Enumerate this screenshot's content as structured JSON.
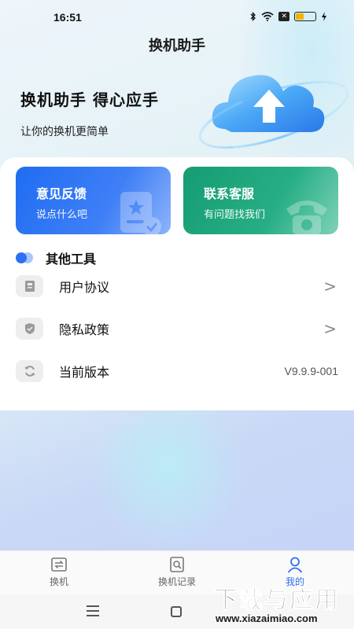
{
  "status_bar": {
    "time": "16:51",
    "x_badge": "✕",
    "battery_level": 0.4,
    "battery_color": "#f0b400"
  },
  "header": {
    "title": "换机助手"
  },
  "hero": {
    "title": "换机助手 得心应手",
    "subtitle": "让你的换机更简单",
    "art_icon": "cloud-upload-icon"
  },
  "feature_cards": [
    {
      "title": "意见反馈",
      "desc": "说点什么吧",
      "color": "#2f6ff3",
      "icon": "feedback-doc-icon"
    },
    {
      "title": "联系客服",
      "desc": "有问题找我们",
      "color": "#22a67d",
      "icon": "telephone-icon"
    }
  ],
  "tools": {
    "title": "其他工具",
    "items": [
      {
        "label": "用户协议",
        "icon": "agreement-book-icon",
        "arrow": ">"
      },
      {
        "label": "隐私政策",
        "icon": "shield-check-icon",
        "arrow": ">"
      },
      {
        "label": "当前版本",
        "icon": "refresh-icon",
        "value": "V9.9.9-001"
      }
    ]
  },
  "tab_bar": {
    "tabs": [
      {
        "label": "换机",
        "icon": "switch-phone-icon",
        "active": false
      },
      {
        "label": "换机记录",
        "icon": "record-search-icon",
        "active": false
      },
      {
        "label": "我的",
        "icon": "person-icon",
        "active": true
      }
    ],
    "active_color": "#2f6ff3"
  },
  "watermark": {
    "big": "下载与应用",
    "small": "www.xiazaimiao.com"
  }
}
